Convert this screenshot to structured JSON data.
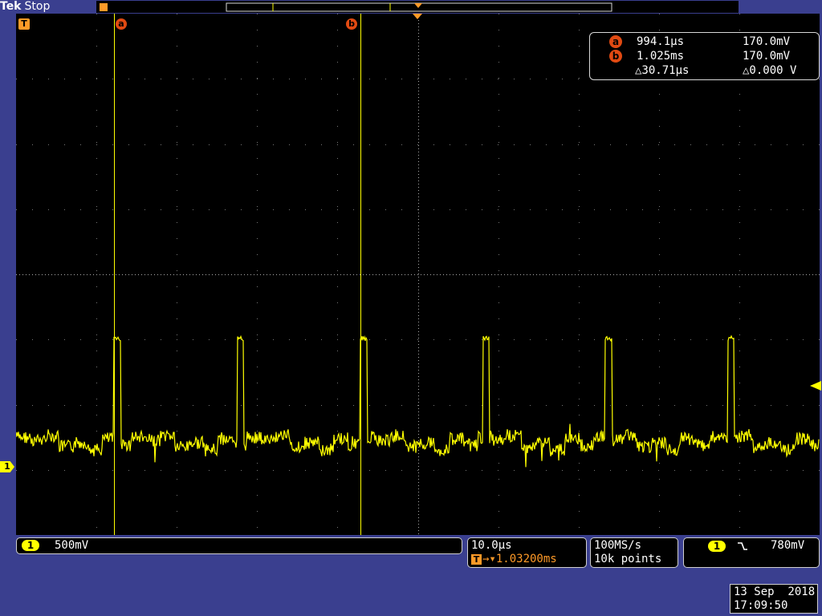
{
  "header": {
    "brand": "Tek",
    "acq_state": "Stop"
  },
  "icons": {
    "trigger_position": "trigger-T-marker-icon",
    "expansion_point": "orange-triangle-icon",
    "trigger_level": "yellow-arrow-icon",
    "channel_ground": "channel-1-ground-icon",
    "trigger_slope": "falling-edge-icon"
  },
  "colors": {
    "trace": "#ffff00",
    "cursor_tag": "#e14a12",
    "trigger": "#ff9a28",
    "background": "#3a3f8f"
  },
  "screen": {
    "trigger_marker_label": "T",
    "cursor_a_label": "a",
    "cursor_b_label": "b",
    "channel_marker_label": "1"
  },
  "cursor_readout": {
    "a_label": "a",
    "a_time": "994.1µs",
    "a_volt": "170.0mV",
    "b_label": "b",
    "b_time": "1.025ms",
    "b_volt": "170.0mV",
    "delta_time": "△30.71µs",
    "delta_volt": "△0.000 V"
  },
  "channel": {
    "badge": "1",
    "scale": "500mV"
  },
  "timebase": {
    "scale": "10.0µs",
    "trigger_icon": "T",
    "position": "→▾1.03200ms"
  },
  "acquisition": {
    "rate": "100MS/s",
    "record": "10k points"
  },
  "trigger": {
    "source": "1",
    "slope": "⌐",
    "level": "780mV"
  },
  "timestamp": {
    "date": "13 Sep  2018",
    "time": "17:09:50"
  }
}
